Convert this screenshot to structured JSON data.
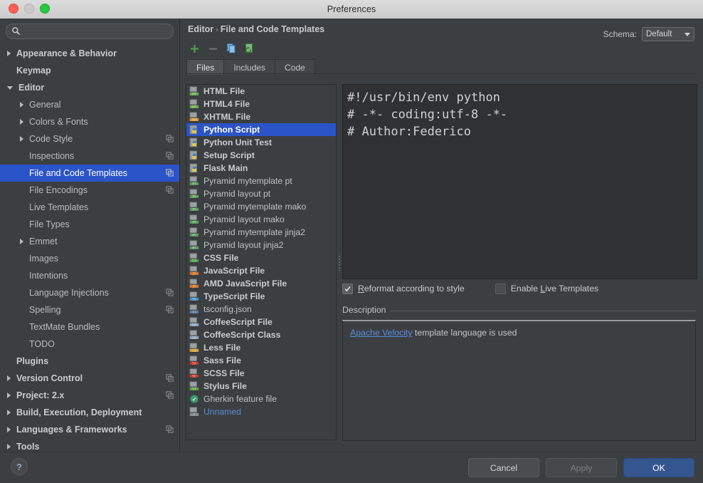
{
  "window": {
    "title": "Preferences",
    "traffic": [
      "close",
      "minimize",
      "zoom"
    ]
  },
  "search": {
    "value": "",
    "placeholder": ""
  },
  "sidebar": {
    "items": [
      {
        "label": "Appearance & Behavior",
        "indent": 0,
        "arrow": "right",
        "bold": true,
        "selected": false,
        "gutter": false
      },
      {
        "label": "Keymap",
        "indent": 0,
        "arrow": "none",
        "bold": true,
        "selected": false,
        "gutter": false
      },
      {
        "label": "Editor",
        "indent": 0,
        "arrow": "down",
        "bold": true,
        "selected": false,
        "gutter": false
      },
      {
        "label": "General",
        "indent": 1,
        "arrow": "right",
        "bold": false,
        "selected": false,
        "gutter": false
      },
      {
        "label": "Colors & Fonts",
        "indent": 1,
        "arrow": "right",
        "bold": false,
        "selected": false,
        "gutter": false
      },
      {
        "label": "Code Style",
        "indent": 1,
        "arrow": "right",
        "bold": false,
        "selected": false,
        "gutter": true
      },
      {
        "label": "Inspections",
        "indent": 1,
        "arrow": "none",
        "bold": false,
        "selected": false,
        "gutter": true
      },
      {
        "label": "File and Code Templates",
        "indent": 1,
        "arrow": "none",
        "bold": false,
        "selected": true,
        "gutter": true
      },
      {
        "label": "File Encodings",
        "indent": 1,
        "arrow": "none",
        "bold": false,
        "selected": false,
        "gutter": true
      },
      {
        "label": "Live Templates",
        "indent": 1,
        "arrow": "none",
        "bold": false,
        "selected": false,
        "gutter": false
      },
      {
        "label": "File Types",
        "indent": 1,
        "arrow": "none",
        "bold": false,
        "selected": false,
        "gutter": false
      },
      {
        "label": "Emmet",
        "indent": 1,
        "arrow": "right",
        "bold": false,
        "selected": false,
        "gutter": false
      },
      {
        "label": "Images",
        "indent": 1,
        "arrow": "none",
        "bold": false,
        "selected": false,
        "gutter": false
      },
      {
        "label": "Intentions",
        "indent": 1,
        "arrow": "none",
        "bold": false,
        "selected": false,
        "gutter": false
      },
      {
        "label": "Language Injections",
        "indent": 1,
        "arrow": "none",
        "bold": false,
        "selected": false,
        "gutter": true
      },
      {
        "label": "Spelling",
        "indent": 1,
        "arrow": "none",
        "bold": false,
        "selected": false,
        "gutter": true
      },
      {
        "label": "TextMate Bundles",
        "indent": 1,
        "arrow": "none",
        "bold": false,
        "selected": false,
        "gutter": false
      },
      {
        "label": "TODO",
        "indent": 1,
        "arrow": "none",
        "bold": false,
        "selected": false,
        "gutter": false
      },
      {
        "label": "Plugins",
        "indent": 0,
        "arrow": "none",
        "bold": true,
        "selected": false,
        "gutter": false
      },
      {
        "label": "Version Control",
        "indent": 0,
        "arrow": "right",
        "bold": true,
        "selected": false,
        "gutter": true
      },
      {
        "label": "Project: 2.x",
        "indent": 0,
        "arrow": "right",
        "bold": true,
        "selected": false,
        "gutter": true
      },
      {
        "label": "Build, Execution, Deployment",
        "indent": 0,
        "arrow": "right",
        "bold": true,
        "selected": false,
        "gutter": false
      },
      {
        "label": "Languages & Frameworks",
        "indent": 0,
        "arrow": "right",
        "bold": true,
        "selected": false,
        "gutter": true
      },
      {
        "label": "Tools",
        "indent": 0,
        "arrow": "right",
        "bold": true,
        "selected": false,
        "gutter": false
      }
    ]
  },
  "header": {
    "breadcrumb_root": "Editor",
    "breadcrumb_sep": "›",
    "breadcrumb_leaf": "File and Code Templates",
    "schema_label": "Schema:",
    "schema_value": "Default"
  },
  "toolbar": {
    "add_label": "+",
    "remove_label": "−",
    "copy_label": "copy-template",
    "reset_label": "reset-to-default"
  },
  "tabs": [
    {
      "label": "Files",
      "active": true
    },
    {
      "label": "Includes",
      "active": false
    },
    {
      "label": "Code",
      "active": false
    }
  ],
  "templates": [
    {
      "label": "HTML File",
      "icon": "html-file-icon",
      "bold": true,
      "selected": false,
      "link": false
    },
    {
      "label": "HTML4 File",
      "icon": "html-file-icon",
      "bold": true,
      "selected": false,
      "link": false
    },
    {
      "label": "XHTML File",
      "icon": "xhtml-file-icon",
      "bold": true,
      "selected": false,
      "link": false
    },
    {
      "label": "Python Script",
      "icon": "python-file-icon",
      "bold": true,
      "selected": true,
      "link": false
    },
    {
      "label": "Python Unit Test",
      "icon": "python-file-icon",
      "bold": true,
      "selected": false,
      "link": false
    },
    {
      "label": "Setup Script",
      "icon": "python-file-icon",
      "bold": true,
      "selected": false,
      "link": false
    },
    {
      "label": "Flask Main",
      "icon": "python-file-icon",
      "bold": true,
      "selected": false,
      "link": false
    },
    {
      "label": "Pyramid mytemplate pt",
      "icon": "pyramid-file-icon",
      "bold": false,
      "selected": false,
      "link": false
    },
    {
      "label": "Pyramid layout pt",
      "icon": "pyramid-file-icon",
      "bold": false,
      "selected": false,
      "link": false
    },
    {
      "label": "Pyramid mytemplate mako",
      "icon": "pyramid-file-icon",
      "bold": false,
      "selected": false,
      "link": false
    },
    {
      "label": "Pyramid layout mako",
      "icon": "pyramid-file-icon",
      "bold": false,
      "selected": false,
      "link": false
    },
    {
      "label": "Pyramid mytemplate jinja2",
      "icon": "pyramid-file-icon",
      "bold": false,
      "selected": false,
      "link": false
    },
    {
      "label": "Pyramid layout jinja2",
      "icon": "pyramid-file-icon",
      "bold": false,
      "selected": false,
      "link": false
    },
    {
      "label": "CSS File",
      "icon": "css-file-icon",
      "bold": true,
      "selected": false,
      "link": false
    },
    {
      "label": "JavaScript File",
      "icon": "javascript-file-icon",
      "bold": true,
      "selected": false,
      "link": false
    },
    {
      "label": "AMD JavaScript File",
      "icon": "javascript-file-icon",
      "bold": true,
      "selected": false,
      "link": false
    },
    {
      "label": "TypeScript File",
      "icon": "typescript-file-icon",
      "bold": true,
      "selected": false,
      "link": false
    },
    {
      "label": "tsconfig.json",
      "icon": "json-file-icon",
      "bold": false,
      "selected": false,
      "link": false
    },
    {
      "label": "CoffeeScript File",
      "icon": "coffeescript-file-icon",
      "bold": true,
      "selected": false,
      "link": false
    },
    {
      "label": "CoffeeScript Class",
      "icon": "coffeescript-file-icon",
      "bold": true,
      "selected": false,
      "link": false
    },
    {
      "label": "Less File",
      "icon": "less-file-icon",
      "bold": true,
      "selected": false,
      "link": false
    },
    {
      "label": "Sass File",
      "icon": "sass-file-icon",
      "bold": true,
      "selected": false,
      "link": false
    },
    {
      "label": "SCSS File",
      "icon": "scss-file-icon",
      "bold": true,
      "selected": false,
      "link": false
    },
    {
      "label": "Stylus File",
      "icon": "stylus-file-icon",
      "bold": true,
      "selected": false,
      "link": false
    },
    {
      "label": "Gherkin feature file",
      "icon": "gherkin-file-icon",
      "bold": false,
      "selected": false,
      "link": false
    },
    {
      "label": "Unnamed",
      "icon": "unnamed-file-icon",
      "bold": false,
      "selected": false,
      "link": true
    }
  ],
  "editor": {
    "code": "#!/usr/bin/env python\n# -*- coding:utf-8 -*-\n# Author:Federico"
  },
  "options": {
    "reformat": {
      "prefix": "",
      "mnemonic": "R",
      "rest": "eformat according to style",
      "checked": true
    },
    "live_templates": {
      "prefix": "Enable ",
      "mnemonic": "L",
      "rest": "ive Templates",
      "checked": false
    }
  },
  "description": {
    "title": "Description",
    "link_text": "Apache Velocity",
    "rest": " template language is used"
  },
  "footer": {
    "help_label": "?",
    "cancel": "Cancel",
    "apply": "Apply",
    "ok": "OK"
  },
  "colors": {
    "selection_blue": "#2b54c8",
    "primary_button": "#35558f",
    "window_bg": "#3c3f41",
    "editor_bg": "#2f3133",
    "link": "#5a8cde"
  }
}
